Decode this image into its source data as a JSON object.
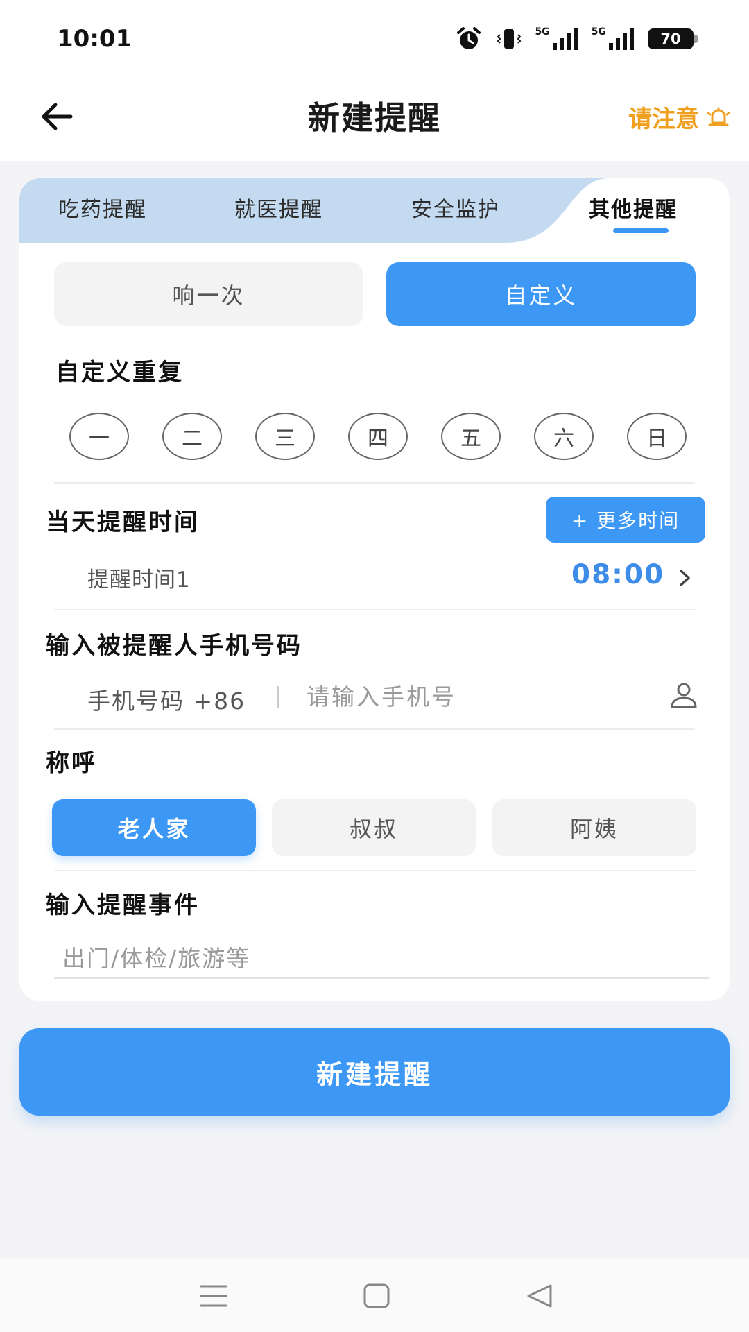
{
  "status_bar": {
    "time": "10:01",
    "net1": "5G",
    "net2": "5G",
    "battery": "70",
    "icons": [
      "alarm-icon",
      "vibrate-icon",
      "signal-icon",
      "signal-icon",
      "battery-icon"
    ]
  },
  "header": {
    "title": "新建提醒",
    "attention_label": "请注意",
    "back_icon": "arrow-left-icon",
    "attention_icon": "bell-icon"
  },
  "tabs": [
    {
      "label": "吃药提醒",
      "active": false
    },
    {
      "label": "就医提醒",
      "active": false
    },
    {
      "label": "安全监护",
      "active": false
    },
    {
      "label": "其他提醒",
      "active": true
    }
  ],
  "repeat_mode": {
    "options": [
      "响一次",
      "自定义"
    ],
    "selected": "自定义"
  },
  "custom_repeat": {
    "title": "自定义重复",
    "days": [
      "一",
      "二",
      "三",
      "四",
      "五",
      "六",
      "日"
    ]
  },
  "reminder_time": {
    "title": "当天提醒时间",
    "more_button": "+ 更多时间",
    "items": [
      {
        "label": "提醒时间1",
        "value": "08:00"
      }
    ]
  },
  "phone": {
    "title": "输入被提醒人手机号码",
    "prefix": "手机号码 +86",
    "placeholder": "请输入手机号",
    "value": ""
  },
  "address": {
    "title": "称呼",
    "options": [
      "老人家",
      "叔叔",
      "阿姨"
    ],
    "selected": "老人家"
  },
  "event": {
    "title": "输入提醒事件",
    "placeholder": "出门/体检/旅游等",
    "value": ""
  },
  "submit_label": "新建提醒",
  "colors": {
    "accent": "#3d98f5",
    "attention": "#f0a020",
    "tab_bar": "#c3daf0"
  }
}
